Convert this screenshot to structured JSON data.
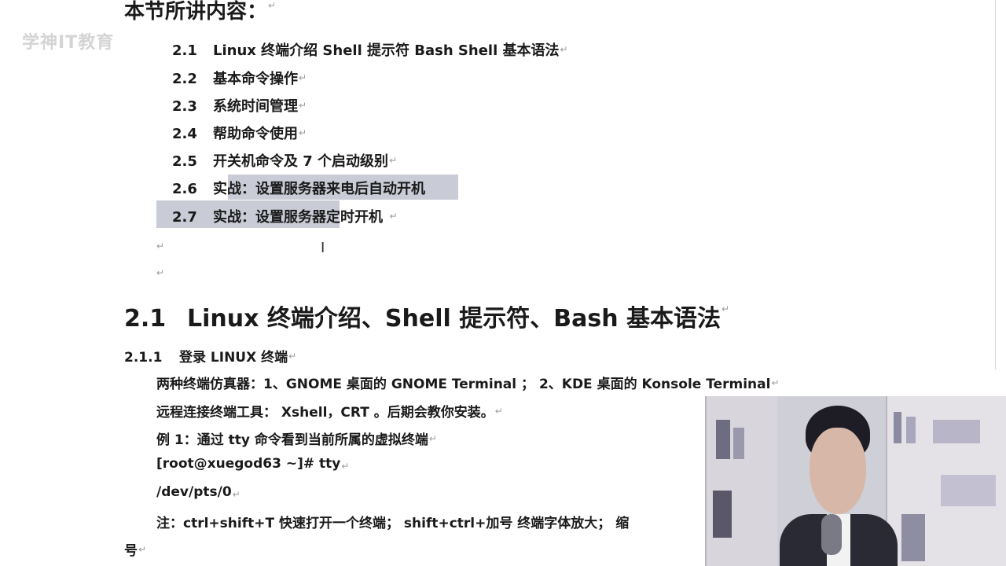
{
  "watermark": "学神IT教育",
  "heading_top": "本节所讲内容：",
  "toc": [
    {
      "num": "2.1",
      "text": "Linux 终端介绍  Shell 提示符  Bash Shell 基本语法"
    },
    {
      "num": "2.2",
      "text": "基本命令操作"
    },
    {
      "num": "2.3",
      "text": "系统时间管理"
    },
    {
      "num": "2.4",
      "text": "帮助命令使用"
    },
    {
      "num": "2.5",
      "text": "开关机命令及 7 个启动级别"
    },
    {
      "num": "2.6",
      "text": "实战：设置服务器来电后自动开机"
    },
    {
      "num": "2.7",
      "text": "实战：设置服务器定时开机"
    }
  ],
  "section": {
    "num": "2.1",
    "title": "Linux 终端介绍、Shell 提示符、Bash 基本语法"
  },
  "subsection": {
    "num": "2.1.1",
    "title": "登录 LINUX 终端"
  },
  "body": [
    "两种终端仿真器：1、GNOME 桌面的 GNOME  Terminal  ；  2、KDE 桌面的 Konsole  Terminal",
    "远程连接终端工具：  Xshell，CRT  。后期会教你安装。",
    "例 1：通过 tty 命令看到当前所属的虚拟终端",
    "[root@xuegod63  ~]# tty",
    "/dev/pts/0",
    "注：ctrl+shift+T  快速打开一个终端；  shift+ctrl+加号    终端字体放大；  缩"
  ],
  "tail": "号",
  "text_cursor": "I"
}
